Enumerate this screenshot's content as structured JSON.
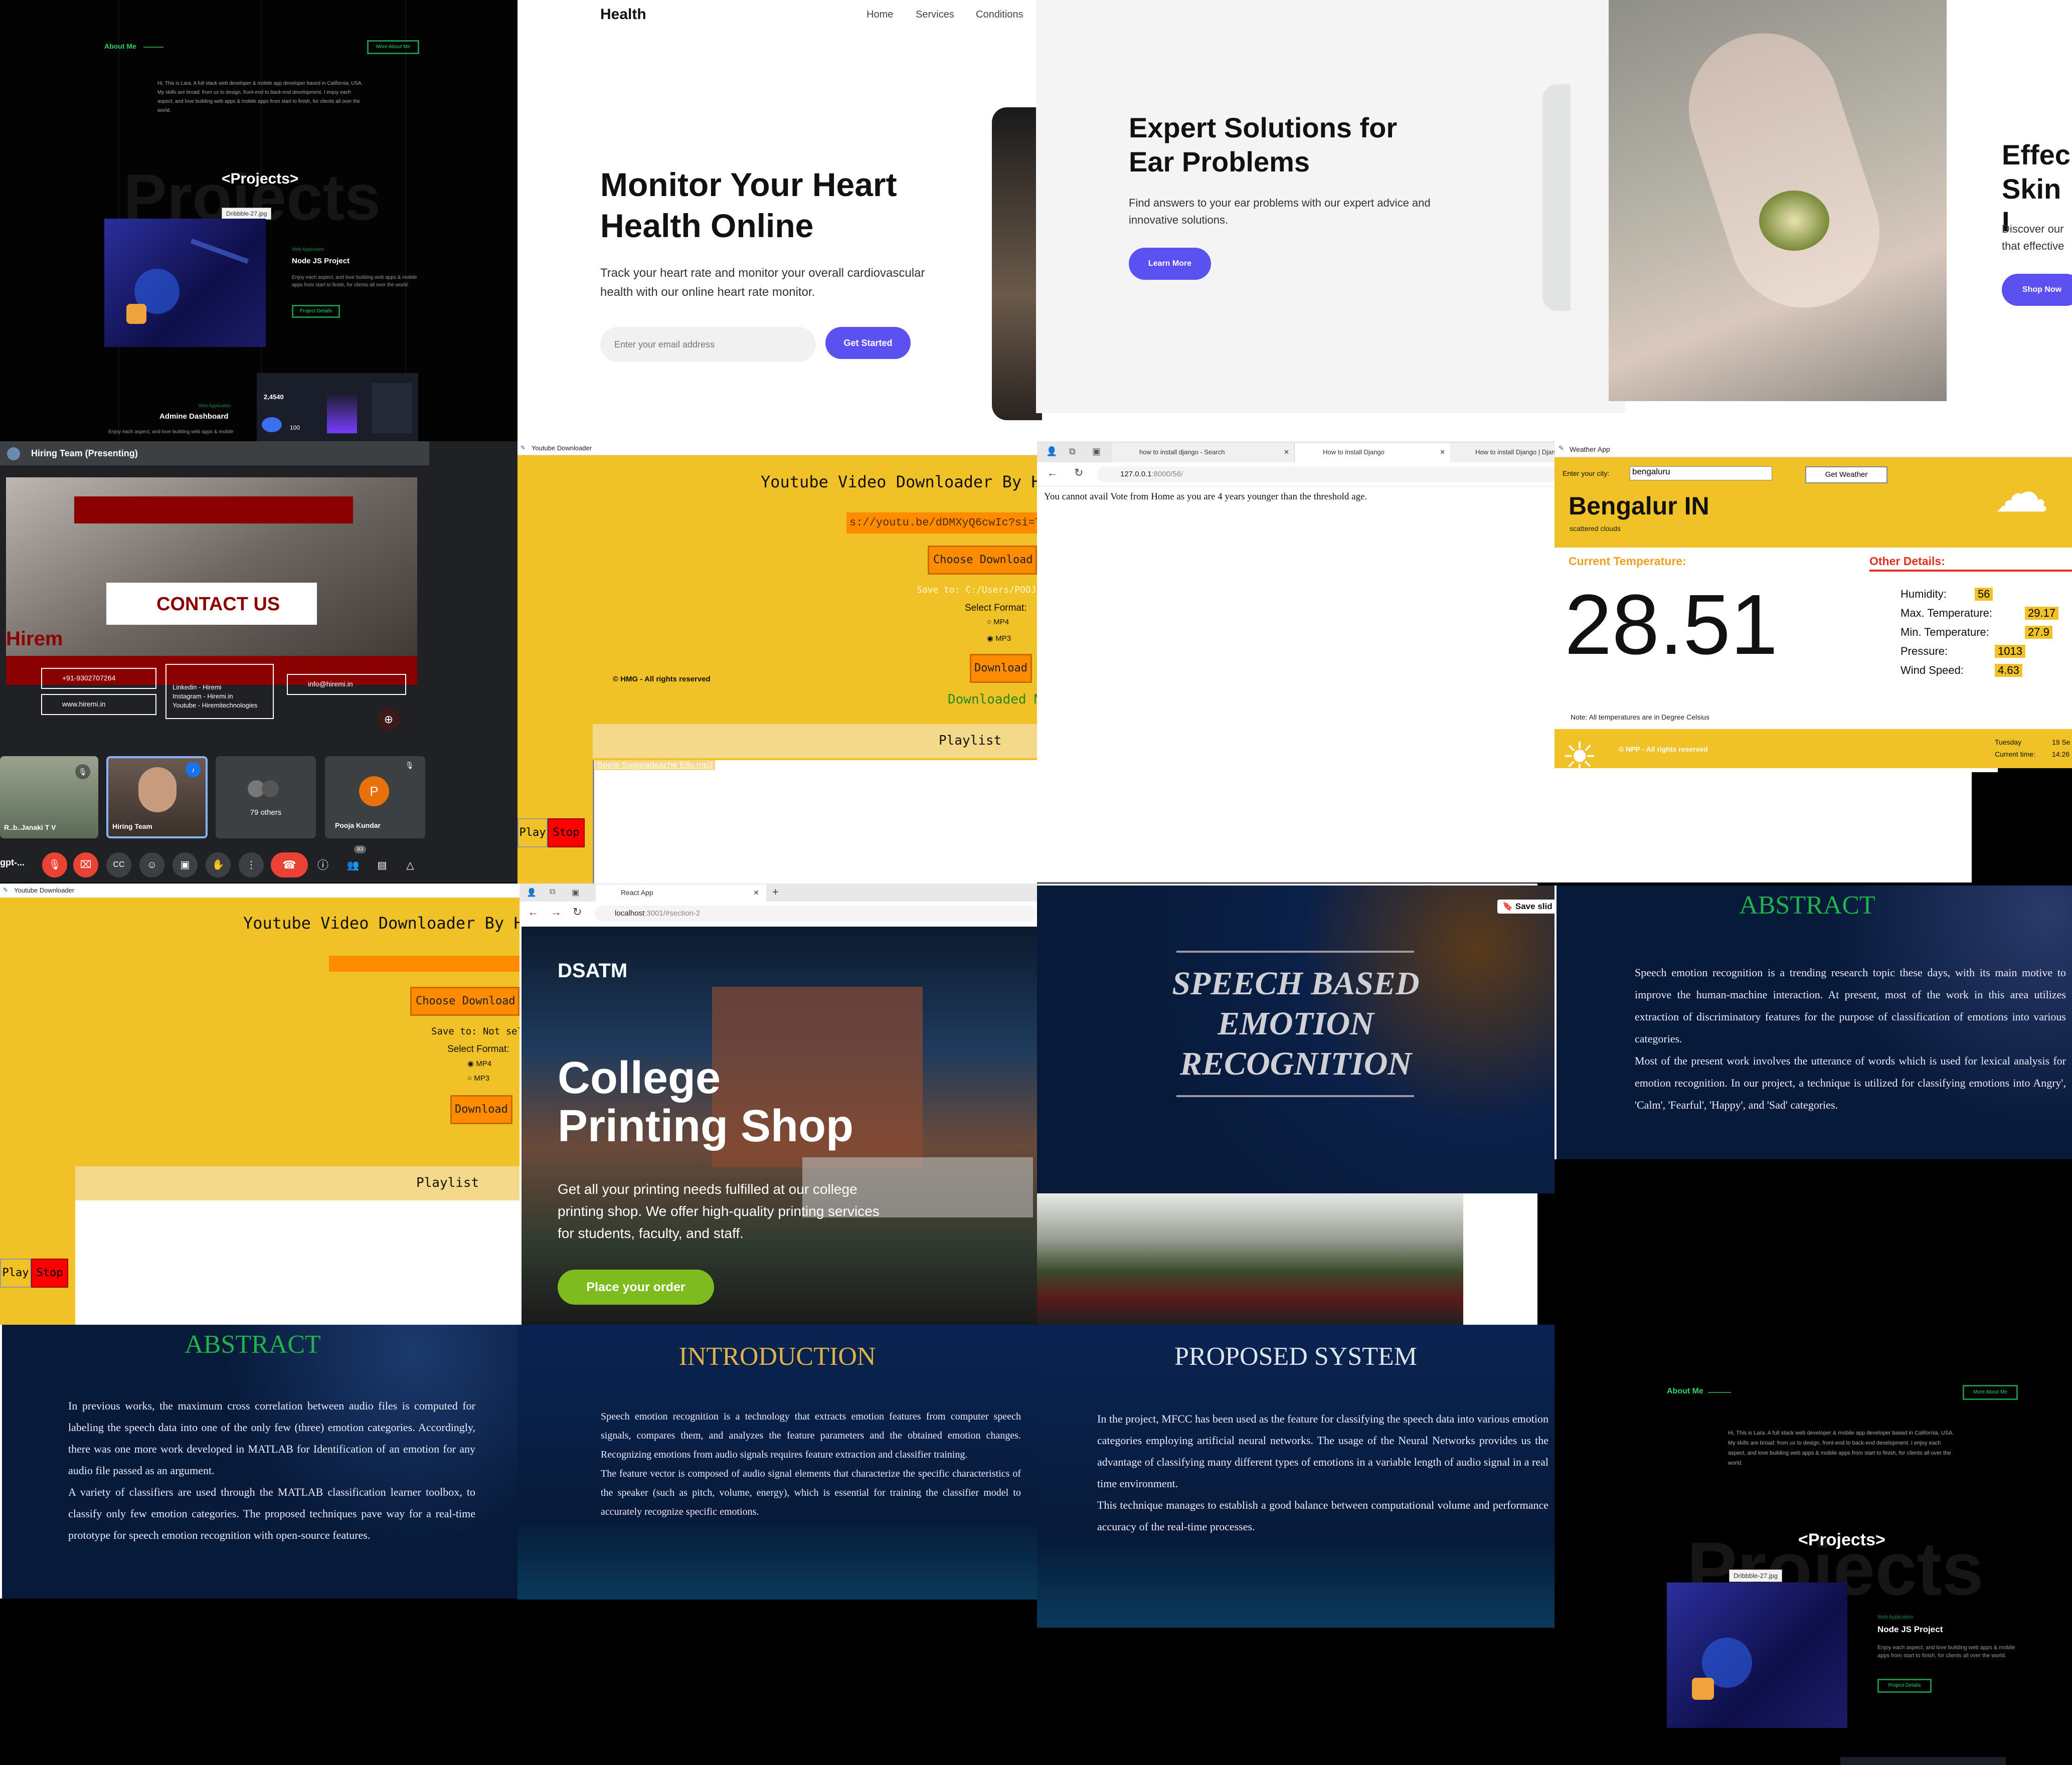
{
  "portfolio": {
    "about_label": "About Me",
    "more_btn": "More About Me",
    "about_text": "Hi, This is Lara. A full stack web developer & mobile app developer based in California, USA. My skills are broad: from ux to design, front-end to back-end development. I enjoy each aspect, and love building web apps & mobile apps from start to finish, for clients all over the world.",
    "projects_heading": "<Projects>",
    "projects_ghost": "Projects",
    "tooltip": "Dribbble-27.jpg",
    "p1_category": "Web Application",
    "p1_title": "Node JS Project",
    "p1_desc": "Enjoy each aspect, and love building web apps & mobile apps from start to finish, for clients all over the world.",
    "p1_btn": "Project Details",
    "p2_category": "Web Application",
    "p2_title": "Admine Dashboard",
    "p2_desc": "Enjoy each aspect, and love building web apps & mobile",
    "dash_value": "2,4540",
    "dash_value2": "100"
  },
  "health": {
    "brand": "Health",
    "nav": [
      "Home",
      "Services",
      "Conditions"
    ],
    "hero_title_1": "Monitor Your Heart",
    "hero_title_2": "Health Online",
    "hero_desc": "Track your heart rate and monitor your overall cardiovascular health with our online heart rate monitor.",
    "email_placeholder": "Enter your email address",
    "cta": "Get Started",
    "ear_title_1": "Expert Solutions for",
    "ear_title_2": "Ear Problems",
    "ear_desc": "Find answers to your ear problems with our expert advice and innovative solutions.",
    "ear_cta": "Learn More",
    "skin_title_1": "Effec",
    "skin_title_2": "Skin I",
    "skin_desc": "Discover our that effective",
    "skin_cta": "Shop Now"
  },
  "meet": {
    "title": "Hiring Team (Presenting)",
    "slide_title": "CONTACT US",
    "brand": "Hirem",
    "phone": "+91-9302707264",
    "web": "www.hiremi.in",
    "social_1": "Linkedin - Hiremi",
    "social_2": "Instagram - Hiremi.in",
    "social_3": "Youtube - Hiremitechnologies",
    "email": "info@hiremi.in",
    "p1": "R..b..Janaki T V",
    "p2": "Hiring Team",
    "others": "79 others",
    "p4": "Pooja Kundar",
    "p4_initial": "P",
    "count": "83",
    "left_label": "gpt-..."
  },
  "yt1": {
    "window_title": "Youtube Downloader",
    "title": "Youtube Video Downloader By Hrut",
    "url": "s://youtu.be/dDMXyQ6cwIc?si=T",
    "choose": "Choose Download F",
    "save": "Save to: C:/Users/POOJ/",
    "fmt_label": "Select Format:",
    "mp4": "MP4",
    "mp3": "MP3",
    "download": "Download",
    "copyright": "© HMG - All rights reserved",
    "status": "Downloaded M",
    "playlist": "Playlist",
    "item": "Beete Sagaradaache Ello.mp3",
    "play": "Play",
    "stop": "Stop"
  },
  "browser1": {
    "tab1": "how to install django - Search",
    "tab2": "How to Install Django",
    "tab3": "How to install Django | Django",
    "url_host": "127.0.0.1",
    "url_path": ":8000/56/",
    "message": "You cannot avail Vote from Home as you are 4 years younger than the threshold age."
  },
  "weather": {
    "window_title": "Weather App",
    "city_label": "Enter your city:",
    "city_value": "bengaluru",
    "btn": "Get Weather",
    "city": "Bengalur IN",
    "desc": "scattered clouds",
    "cur_label": "Current Temperature:",
    "temp": "28.51",
    "other_label": "Other Details:",
    "rows": [
      {
        "k": "Humidity:",
        "v": "56"
      },
      {
        "k": "Max. Temperature:",
        "v": "29.17"
      },
      {
        "k": "Min. Temperature:",
        "v": "27.9"
      },
      {
        "k": "Pressure:",
        "v": "1013"
      },
      {
        "k": "Wind Speed:",
        "v": "4.63"
      }
    ],
    "note": "Note: All temperatures are in Degree Celsius",
    "footer": "© NPP - All rights reserved",
    "day": "Tuesday",
    "date": "19 Se",
    "time_label": "Current time:",
    "time": "14:26"
  },
  "yt2": {
    "window_title": "Youtube Downloader",
    "title": "Youtube Video Downloader By Hrut",
    "choose": "Choose Download F",
    "save": "Save to: Not select",
    "fmt_label": "Select Format:",
    "mp4": "MP4",
    "mp3": "MP3",
    "download": "Download",
    "playlist": "Playlist",
    "play": "Play",
    "stop": "Stop"
  },
  "react": {
    "tab": "React App",
    "url_host": "localhost",
    "url_path": ":3001/#section-2",
    "brand": "DSATM",
    "h1": "College",
    "h2": "Printing Shop",
    "desc": "Get all your printing needs fulfilled at our college printing shop. We offer high-quality printing services for students, faculty, and staff.",
    "cta": "Place your order"
  },
  "speech": {
    "save_slide": "Save slid",
    "l1": "SPEECH BASED",
    "l2": "EMOTION",
    "l3": "RECOGNITION"
  },
  "abstract1": {
    "title": "ABSTRACT",
    "b1": "Speech emotion recognition is a trending research topic these days, with its main motive to improve the human-machine interaction. At present, most of the work in this area utilizes extraction of discriminatory features for the purpose of classification of emotions into various categories.",
    "b2": "Most of the present work involves the utterance of words which is used for lexical analysis for emotion recognition. In our project, a technique is utilized for classifying emotions into Angry', 'Calm', 'Fearful', 'Happy', and 'Sad' categories."
  },
  "abstract2": {
    "title": "ABSTRACT",
    "b1": "In previous works, the maximum cross correlation between audio files is computed for labeling the speech data into one of the only few (three) emotion categories. Accordingly, there was one more work developed in MATLAB for Identification of an emotion for any audio file passed as an argument.",
    "b2": "A variety of classifiers are used through the MATLAB classification learner toolbox, to classify only few emotion categories. The proposed techniques pave way for a real-time prototype for speech emotion recognition with open-source features."
  },
  "intro": {
    "title": "INTRODUCTION",
    "b1": "Speech emotion recognition is a technology that extracts emotion features from computer speech signals, compares them, and analyzes the feature parameters and the obtained emotion changes. Recognizing emotions from audio signals requires feature extraction and classifier training.",
    "b2": "The feature vector is composed of audio signal elements that characterize the specific characteristics of the speaker (such as pitch, volume, energy), which is essential for training the classifier model to accurately recognize specific emotions."
  },
  "proposed": {
    "title": "PROPOSED SYSTEM",
    "b1": "In the project, MFCC has been used as the feature for classifying the speech data into various emotion categories employing artificial neural networks. The usage of the Neural Networks provides us the advantage of classifying many different types of emotions in a variable length of audio signal in a real time environment.",
    "b2": "This technique manages to establish a good balance between computational volume and performance accuracy of the real-time processes."
  },
  "colors": {
    "green": "#2fd36a",
    "purple": "#5b50f0",
    "yellow": "#f0c228",
    "orange": "#ff8c00",
    "slide_bg": "#071a3a",
    "abstract_green": "#1fb34a",
    "intro_gold": "#e0b24a"
  }
}
